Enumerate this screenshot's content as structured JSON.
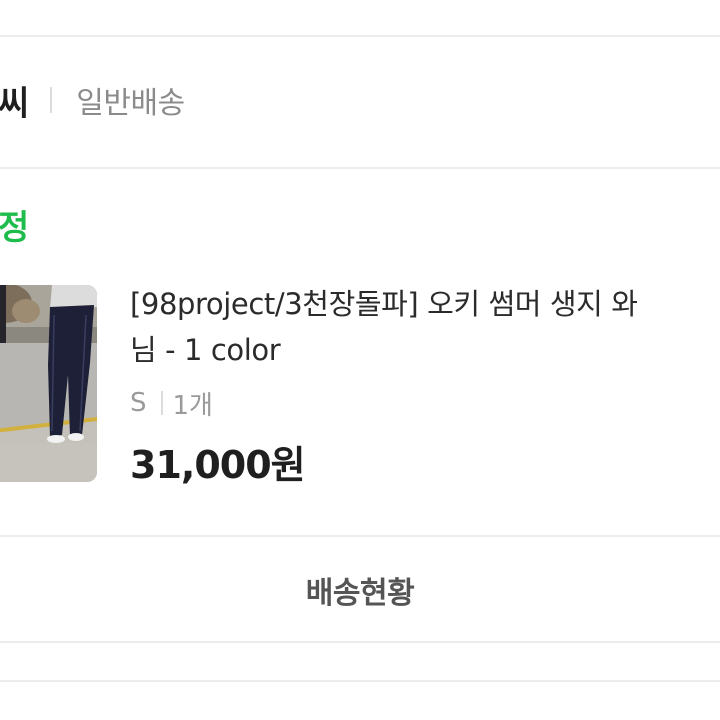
{
  "order": {
    "store_name": "씨",
    "shipping_type": "일반배송",
    "status": "정",
    "status_color": "#1ebc4a"
  },
  "product": {
    "image_icon": "product-photo",
    "name_line1": "[98project/3천장돌파] 오키 썸머 생지 와",
    "name_line2": "님 - 1 color",
    "option_size": "S",
    "quantity": "1개",
    "price": "31,000원"
  },
  "actions": {
    "track_label": "배송현황"
  }
}
